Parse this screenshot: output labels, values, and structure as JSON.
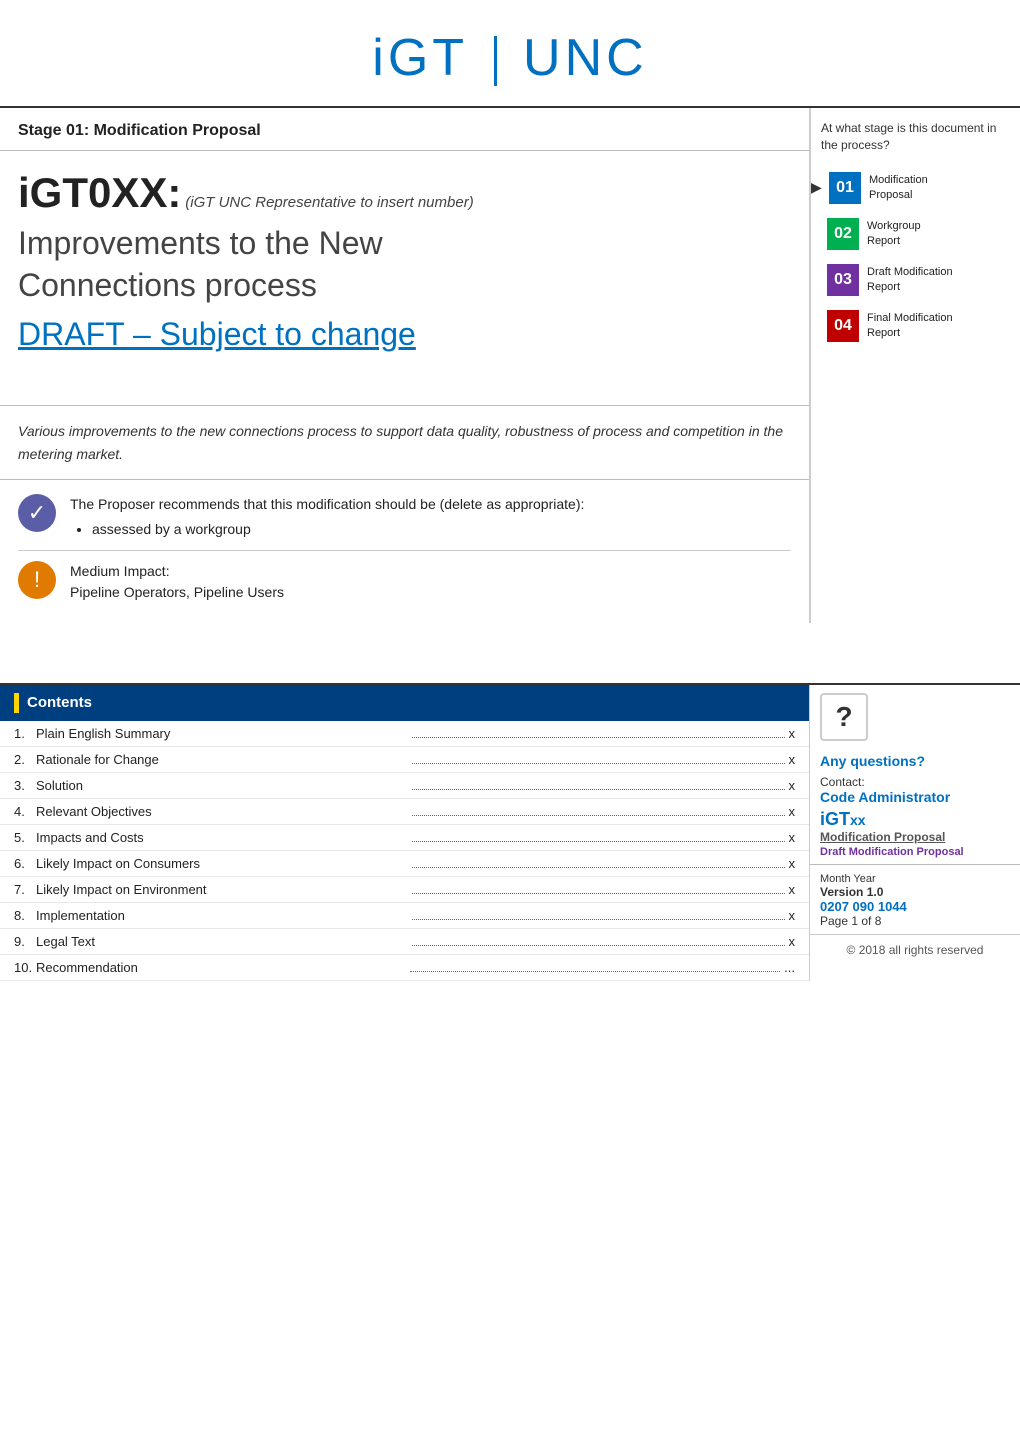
{
  "header": {
    "logo_left": "iGT",
    "logo_right": "UNC"
  },
  "stage_bar": {
    "title": "Stage 01: Modification Proposal"
  },
  "document": {
    "id": "iGT0XX:",
    "id_note": "(iGT UNC Representative to insert number)",
    "subtitle": "Improvements to the New\nConnections process",
    "draft_label": "DRAFT – Subject to change"
  },
  "description": "Various improvements to the new connections process to support data quality, robustness of process and competition in the metering market.",
  "recommendation": {
    "check_text": "The Proposer recommends that this modification should be (delete as appropriate):",
    "check_items": [
      "assessed by a workgroup"
    ],
    "warn_text": "Medium Impact:\nPipeline Operators, Pipeline Users"
  },
  "stage_question": "At what stage is this document in the process?",
  "stages": [
    {
      "num": "01",
      "label": "Modification\nProposal",
      "class": "s01",
      "active": true
    },
    {
      "num": "02",
      "label": "Workgroup\nReport",
      "class": "s02",
      "active": false
    },
    {
      "num": "03",
      "label": "Draft Modification\nReport",
      "class": "s03",
      "active": false
    },
    {
      "num": "04",
      "label": "Final Modification\nReport",
      "class": "s04",
      "active": false
    }
  ],
  "contents": {
    "title": "Contents",
    "items": [
      {
        "num": "1.",
        "label": "Plain English Summary",
        "page": "x"
      },
      {
        "num": "2.",
        "label": "Rationale for Change",
        "page": "x"
      },
      {
        "num": "3.",
        "label": "Solution",
        "page": "x"
      },
      {
        "num": "4.",
        "label": "Relevant Objectives",
        "page": "x"
      },
      {
        "num": "5.",
        "label": "Impacts and Costs",
        "page": "x"
      },
      {
        "num": "6.",
        "label": "Likely Impact on Consumers",
        "page": "x"
      },
      {
        "num": "7.",
        "label": "Likely Impact on Environment",
        "page": "x"
      },
      {
        "num": "8.",
        "label": "Implementation",
        "page": "x"
      },
      {
        "num": "9.",
        "label": "Legal Text",
        "page": "x"
      },
      {
        "num": "10.",
        "label": "Recommendation",
        "page": "..."
      }
    ]
  },
  "info": {
    "any_questions_label": "Any questions?",
    "contact_label": "Contact:",
    "contact_name": "Code Administrator",
    "igt_logo": "iGTxx",
    "mod_proposal": "Modification Proposal",
    "month": "Month Year",
    "version": "Version 1.0",
    "phone": "0207 090 1044",
    "page": "Page 1 of 8",
    "copyright": "© 2018 all rights reserved"
  }
}
